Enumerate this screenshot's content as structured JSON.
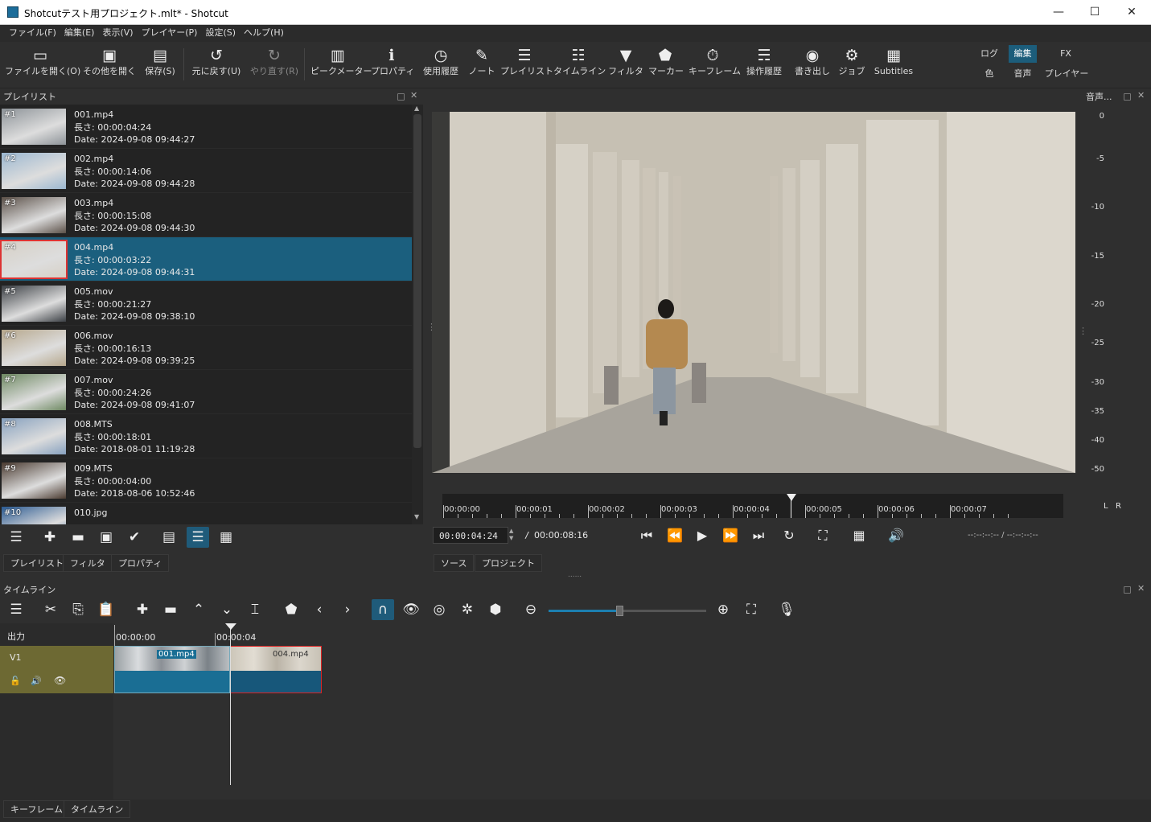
{
  "window": {
    "title": "Shotcutテスト用プロジェクト.mlt* - Shotcut",
    "minimize": "—",
    "maximize": "☐",
    "close": "✕"
  },
  "menu": [
    "ファイル(F)",
    "編集(E)",
    "表示(V)",
    "プレイヤー(P)",
    "設定(S)",
    "ヘルプ(H)"
  ],
  "toolbar": {
    "open": "ファイルを開く(O)",
    "open_other": "その他を開く",
    "save": "保存(S)",
    "undo": "元に戻す(U)",
    "redo": "やり直す(R)",
    "peak_meter": "ピークメーター",
    "properties": "プロパティ",
    "recent": "使用履歴",
    "notes": "ノート",
    "playlist": "プレイリスト",
    "timeline": "タイムライン",
    "filters": "フィルタ",
    "markers": "マーカー",
    "keyframes": "キーフレーム",
    "history": "操作履歴",
    "export": "書き出し",
    "jobs": "ジョブ",
    "subtitles": "Subtitles"
  },
  "layouts": {
    "log": "ログ",
    "edit": "編集",
    "fx": "FX",
    "color": "色",
    "audio": "音声",
    "player": "プレイヤー"
  },
  "playlist": {
    "title": "プレイリスト",
    "items": [
      {
        "num": "#1",
        "name": "001.mp4",
        "length": "長さ: 00:00:04:24",
        "date": "Date: 2024-09-08 09:44:27"
      },
      {
        "num": "#2",
        "name": "002.mp4",
        "length": "長さ: 00:00:14:06",
        "date": "Date: 2024-09-08 09:44:28"
      },
      {
        "num": "#3",
        "name": "003.mp4",
        "length": "長さ: 00:00:15:08",
        "date": "Date: 2024-09-08 09:44:30"
      },
      {
        "num": "#4",
        "name": "004.mp4",
        "length": "長さ: 00:00:03:22",
        "date": "Date: 2024-09-08 09:44:31"
      },
      {
        "num": "#5",
        "name": "005.mov",
        "length": "長さ: 00:00:21:27",
        "date": "Date: 2024-09-08 09:38:10"
      },
      {
        "num": "#6",
        "name": "006.mov",
        "length": "長さ: 00:00:16:13",
        "date": "Date: 2024-09-08 09:39:25"
      },
      {
        "num": "#7",
        "name": "007.mov",
        "length": "長さ: 00:00:24:26",
        "date": "Date: 2024-09-08 09:41:07"
      },
      {
        "num": "#8",
        "name": "008.MTS",
        "length": "長さ: 00:00:18:01",
        "date": "Date: 2018-08-01 11:19:28"
      },
      {
        "num": "#9",
        "name": "009.MTS",
        "length": "長さ: 00:00:04:00",
        "date": "Date: 2018-08-06 10:52:46"
      },
      {
        "num": "#10",
        "name": "010.jpg",
        "length": "",
        "date": ""
      }
    ],
    "tabs": [
      "プレイリスト",
      "フィルタ",
      "プロパティ"
    ]
  },
  "audio_meter": {
    "title": "音声...",
    "scale": [
      "0",
      "-5",
      "-10",
      "-15",
      "-20",
      "-25",
      "-30",
      "-35",
      "-40",
      "-50"
    ],
    "left": "L",
    "right": "R"
  },
  "player": {
    "ruler_labels": [
      "00:00:00",
      "00:00:01",
      "00:00:02",
      "00:00:03",
      "00:00:04",
      "00:00:05",
      "00:00:06",
      "00:00:07"
    ],
    "position": "00:00:04:24",
    "separator": "/",
    "duration": "00:00:08:16",
    "in_out": "--:--:--:--  /  --:--:--:--",
    "tabs": [
      "ソース",
      "プロジェクト"
    ]
  },
  "timeline": {
    "title": "タイムライン",
    "output_label": "出力",
    "track_name": "V1",
    "ruler_labels": [
      "00:00:00",
      "00:00:04"
    ],
    "clips": [
      "001.mp4",
      "004.mp4"
    ],
    "zoom": 0.45
  },
  "bottom_tabs": [
    "キーフレーム",
    "タイムライン"
  ],
  "splitter": "......"
}
